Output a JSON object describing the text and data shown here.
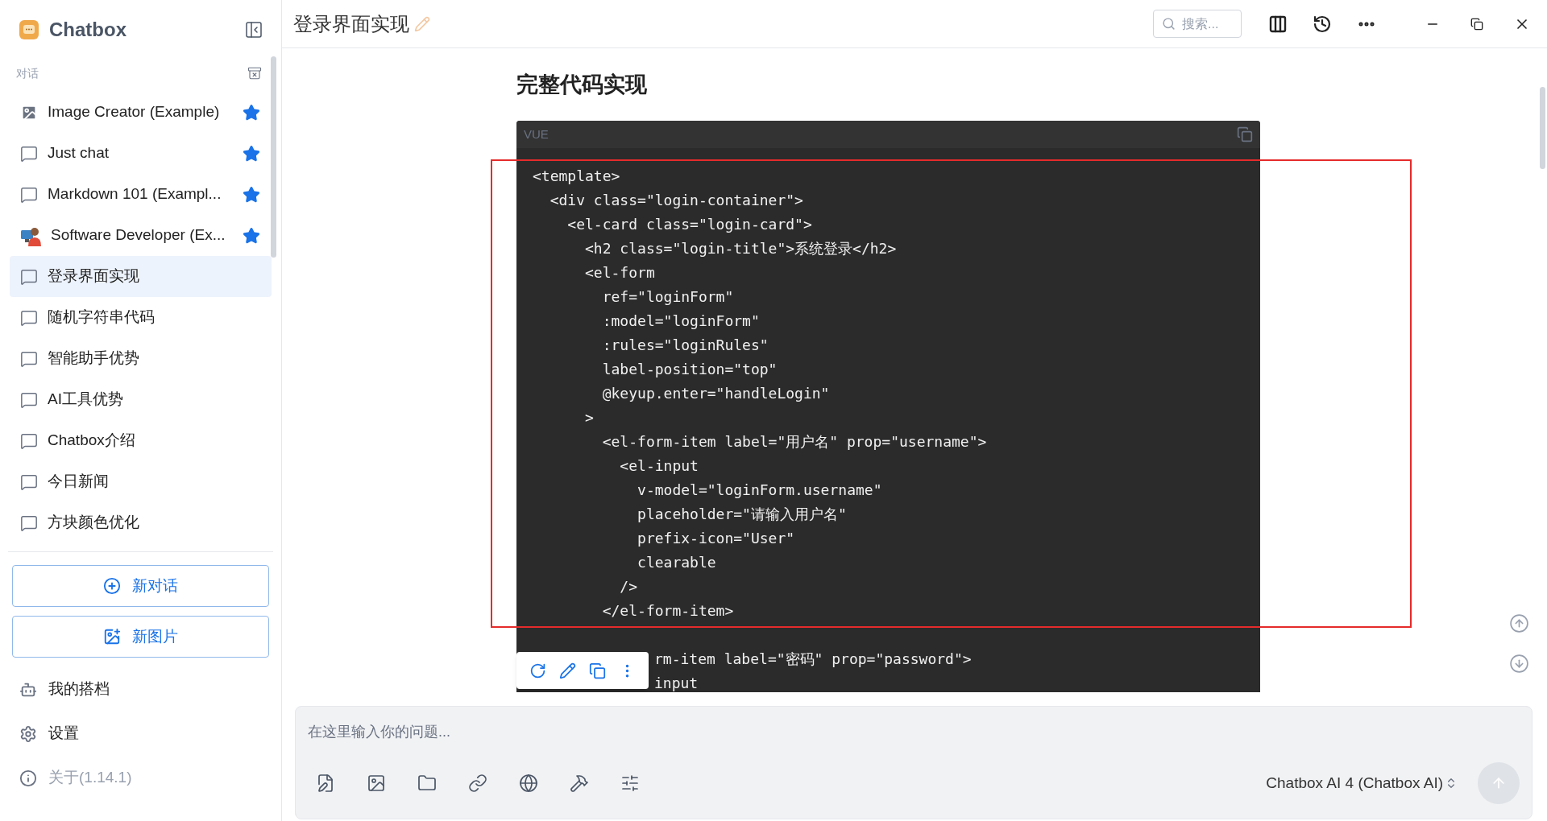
{
  "sidebar": {
    "app_name": "Chatbox",
    "section_label": "对话",
    "items": [
      {
        "label": "Image Creator (Example)",
        "kind": "image",
        "starred": true,
        "selected": false
      },
      {
        "label": "Just chat",
        "kind": "chat",
        "starred": true,
        "selected": false
      },
      {
        "label": "Markdown 101 (Exampl...",
        "kind": "chat",
        "starred": true,
        "selected": false
      },
      {
        "label": "Software Developer (Ex...",
        "kind": "avatar",
        "starred": true,
        "selected": false
      },
      {
        "label": "登录界面实现",
        "kind": "chat",
        "starred": false,
        "selected": true
      },
      {
        "label": "随机字符串代码",
        "kind": "chat",
        "starred": false,
        "selected": false
      },
      {
        "label": "智能助手优势",
        "kind": "chat",
        "starred": false,
        "selected": false
      },
      {
        "label": "AI工具优势",
        "kind": "chat",
        "starred": false,
        "selected": false
      },
      {
        "label": "Chatbox介绍",
        "kind": "chat",
        "starred": false,
        "selected": false
      },
      {
        "label": "今日新闻",
        "kind": "chat",
        "starred": false,
        "selected": false
      },
      {
        "label": "方块颜色优化",
        "kind": "chat",
        "starred": false,
        "selected": false
      }
    ],
    "buttons": [
      {
        "label": "新对话",
        "kind": "chat"
      },
      {
        "label": "新图片",
        "kind": "image"
      }
    ],
    "links": [
      {
        "label": "我的搭档",
        "kind": "bot",
        "disabled": false
      },
      {
        "label": "设置",
        "kind": "settings",
        "disabled": false
      },
      {
        "label": "关于(1.14.1)",
        "kind": "info",
        "disabled": true
      }
    ]
  },
  "header": {
    "title": "登录界面实现",
    "search": {
      "placeholder": "搜索..."
    }
  },
  "message": {
    "heading": "完整代码实现",
    "code": {
      "language": "VUE",
      "text": "<template>\n  <div class=\"login-container\">\n    <el-card class=\"login-card\">\n      <h2 class=\"login-title\">系统登录</h2>\n      <el-form\n        ref=\"loginForm\"\n        :model=\"loginForm\"\n        :rules=\"loginRules\"\n        label-position=\"top\"\n        @keyup.enter=\"handleLogin\"\n      >\n        <el-form-item label=\"用户名\" prop=\"username\">\n          <el-input\n            v-model=\"loginForm.username\"\n            placeholder=\"请输入用户名\"\n            prefix-icon=\"User\"\n            clearable\n          />\n        </el-form-item>",
      "partial_lines": [
        "rm-item label=\"密码\" prop=\"password\">",
        "input"
      ]
    }
  },
  "composer": {
    "placeholder": "在这里输入你的问题...",
    "model": "Chatbox AI 4 (Chatbox AI)"
  }
}
